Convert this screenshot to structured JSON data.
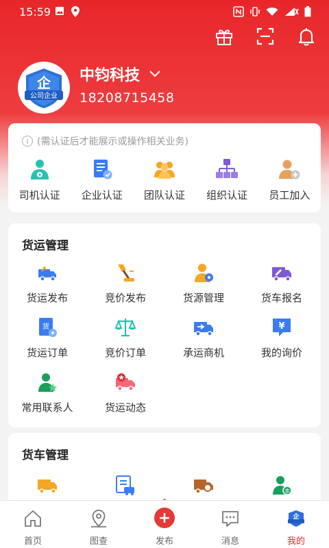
{
  "status_bar": {
    "time": "15:59"
  },
  "profile": {
    "company_name": "中钧科技",
    "phone": "18208715458",
    "badge_text": "公司企业",
    "badge_char": "企"
  },
  "auth": {
    "notice": "(需认证后才能展示或操作相关业务)",
    "items": [
      {
        "label": "司机认证",
        "icon": "driver-icon"
      },
      {
        "label": "企业认证",
        "icon": "enterprise-icon"
      },
      {
        "label": "团队认证",
        "icon": "team-icon"
      },
      {
        "label": "组织认证",
        "icon": "org-icon"
      },
      {
        "label": "员工加入",
        "icon": "staff-join-icon"
      }
    ]
  },
  "freight": {
    "title": "货运管理",
    "items": [
      {
        "label": "货运发布",
        "icon": "freight-publish-icon"
      },
      {
        "label": "竞价发布",
        "icon": "bid-publish-icon"
      },
      {
        "label": "货源管理",
        "icon": "source-manage-icon"
      },
      {
        "label": "货车报名",
        "icon": "truck-signup-icon"
      },
      {
        "label": "货运订单",
        "icon": "freight-order-icon"
      },
      {
        "label": "竞价订单",
        "icon": "bid-order-icon"
      },
      {
        "label": "承运商机",
        "icon": "carrier-opportunity-icon"
      },
      {
        "label": "我的询价",
        "icon": "my-inquiry-icon"
      },
      {
        "label": "常用联系人",
        "icon": "contacts-icon"
      },
      {
        "label": "货运动态",
        "icon": "freight-news-icon"
      }
    ]
  },
  "truck": {
    "title": "货车管理"
  },
  "nav": {
    "items": [
      {
        "label": "首页"
      },
      {
        "label": "图查"
      },
      {
        "label": "发布"
      },
      {
        "label": "消息"
      },
      {
        "label": "我的"
      }
    ]
  },
  "colors": {
    "brand": "#e8262a",
    "blue": "#3b7cf0",
    "orange": "#f5a623",
    "teal": "#26c2b3",
    "purple": "#7d5bd6"
  }
}
